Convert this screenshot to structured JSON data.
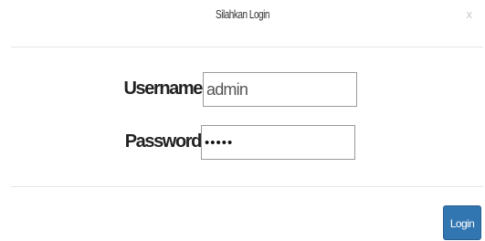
{
  "modal": {
    "title": "Silahkan Login",
    "close_label": "x"
  },
  "form": {
    "username_label": "Username",
    "username_value": "admin",
    "password_label": "Password",
    "password_value": "•••••"
  },
  "footer": {
    "login_label": "Login"
  },
  "colors": {
    "button_primary": "#3276b1",
    "divider": "#e5e5e5",
    "input_border": "#9a9a9a"
  }
}
